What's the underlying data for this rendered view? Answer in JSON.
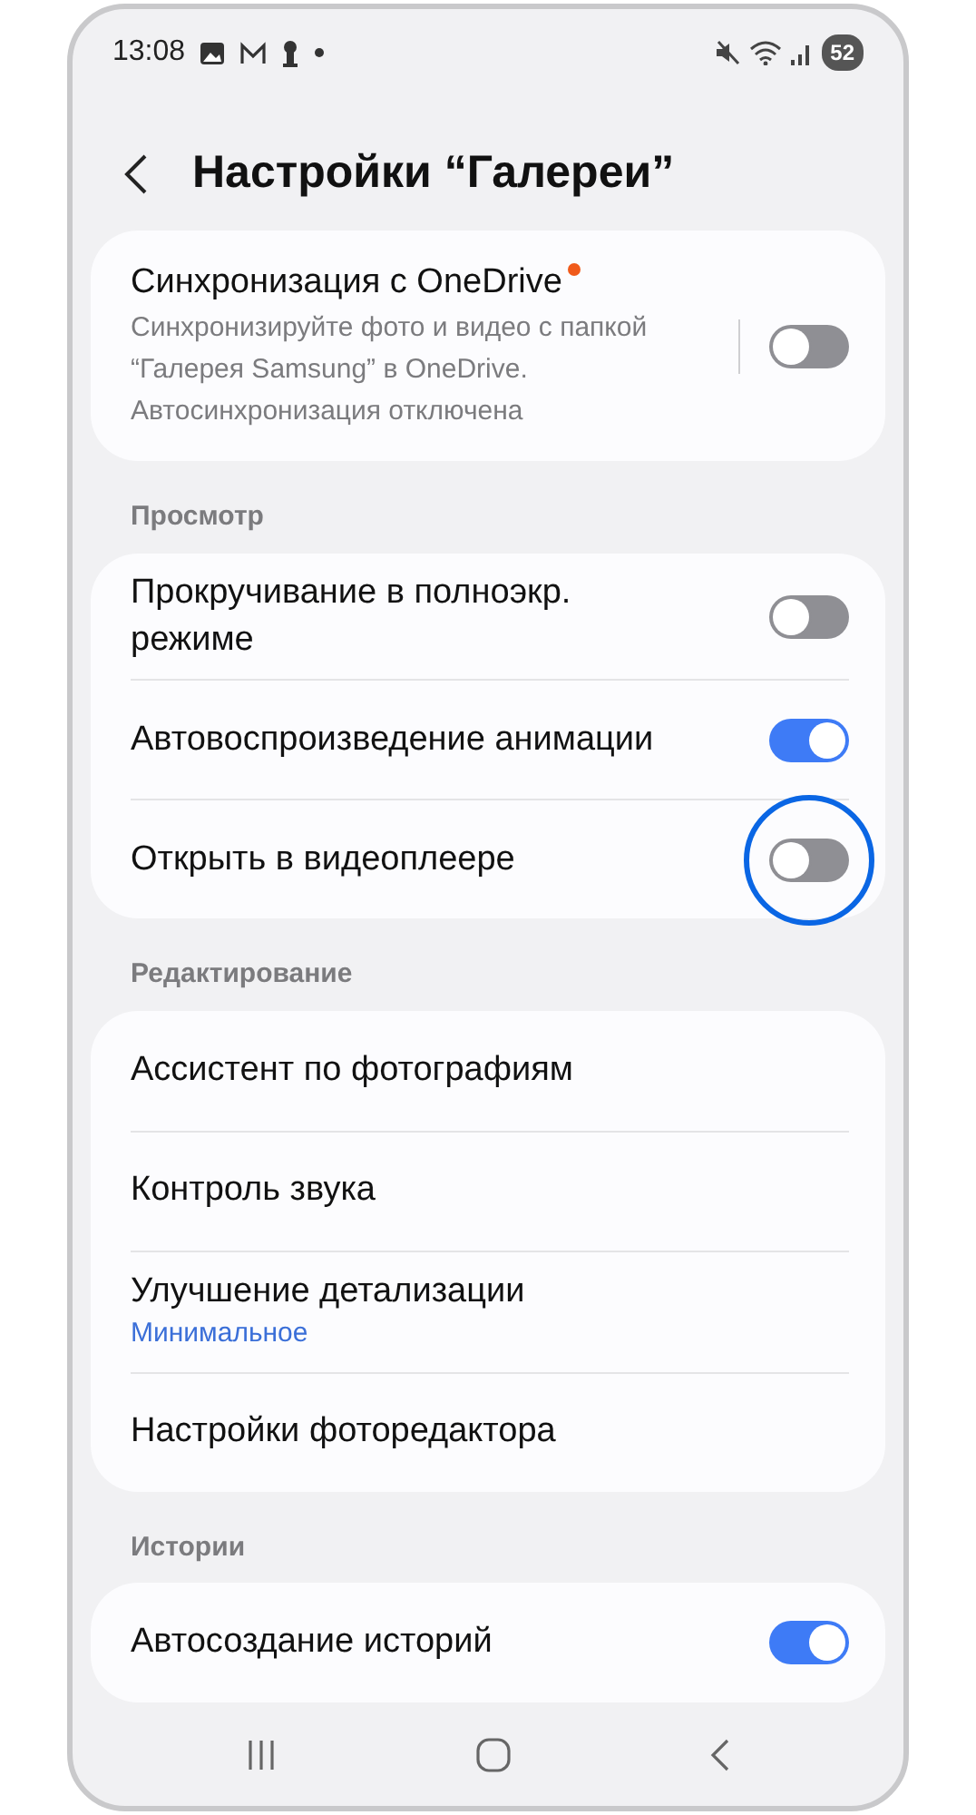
{
  "status_bar": {
    "time": "13:08",
    "battery": "52"
  },
  "header": {
    "title": "Настройки “Галереи”"
  },
  "sections": [
    {
      "items": [
        {
          "kind": "split_toggle",
          "title": "Синхронизация с OneDrive",
          "new_badge": true,
          "description": "Синхронизируйте фото и видео с папкой “Галерея Samsung” в OneDrive. Автосинхронизация отключена",
          "on": false,
          "highlighted": false
        }
      ]
    },
    {
      "title": "Просмотр",
      "items": [
        {
          "kind": "toggle",
          "title": "Прокручивание в полноэкр. режиме",
          "on": false,
          "highlighted": false
        },
        {
          "kind": "toggle",
          "title": "Автовоспроизведение анимации",
          "on": true,
          "highlighted": false
        },
        {
          "kind": "toggle",
          "title": "Открыть в видеоплеере",
          "on": false,
          "highlighted": true
        }
      ]
    },
    {
      "title": "Редактирование",
      "items": [
        {
          "kind": "link",
          "title": "Ассистент по фотографиям"
        },
        {
          "kind": "link",
          "title": "Контроль звука"
        },
        {
          "kind": "link",
          "title": "Улучшение детализации",
          "value": "Минимальное"
        },
        {
          "kind": "link",
          "title": "Настройки фоторедактора"
        }
      ]
    },
    {
      "title": "Истории",
      "items": [
        {
          "kind": "toggle",
          "title": "Автосоздание историй",
          "on": true,
          "highlighted": false
        }
      ]
    }
  ]
}
